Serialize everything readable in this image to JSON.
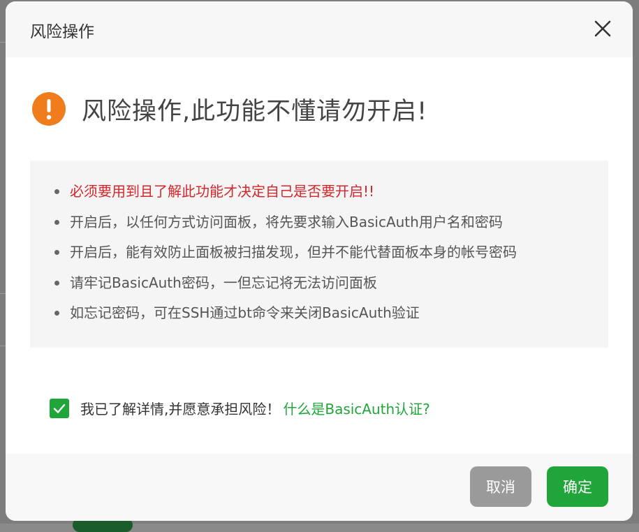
{
  "dialog": {
    "title": "风险操作",
    "close_icon": "close-icon"
  },
  "warning": {
    "icon": "exclamation-circle-icon",
    "icon_color": "#f07d1c",
    "text": "风险操作,此功能不懂请勿开启!"
  },
  "notices": [
    {
      "text": "必须要用到且了解此功能才决定自己是否要开启!!",
      "highlight": true
    },
    {
      "text": "开启后，以任何方式访问面板，将先要求输入BasicAuth用户名和密码",
      "highlight": false
    },
    {
      "text": "开启后，能有效防止面板被扫描发现，但并不能代替面板本身的帐号密码",
      "highlight": false
    },
    {
      "text": "请牢记BasicAuth密码，一但忘记将无法访问面板",
      "highlight": false
    },
    {
      "text": "如忘记密码，可在SSH通过bt命令来关闭BasicAuth验证",
      "highlight": false
    }
  ],
  "agreement": {
    "checked": true,
    "label": "我已了解详情,并愿意承担风险！",
    "link": "什么是BasicAuth认证?"
  },
  "buttons": {
    "cancel": "取消",
    "confirm": "确定"
  },
  "colors": {
    "accent": "#20a53a",
    "danger": "#d6262a",
    "warning": "#f07d1c"
  }
}
